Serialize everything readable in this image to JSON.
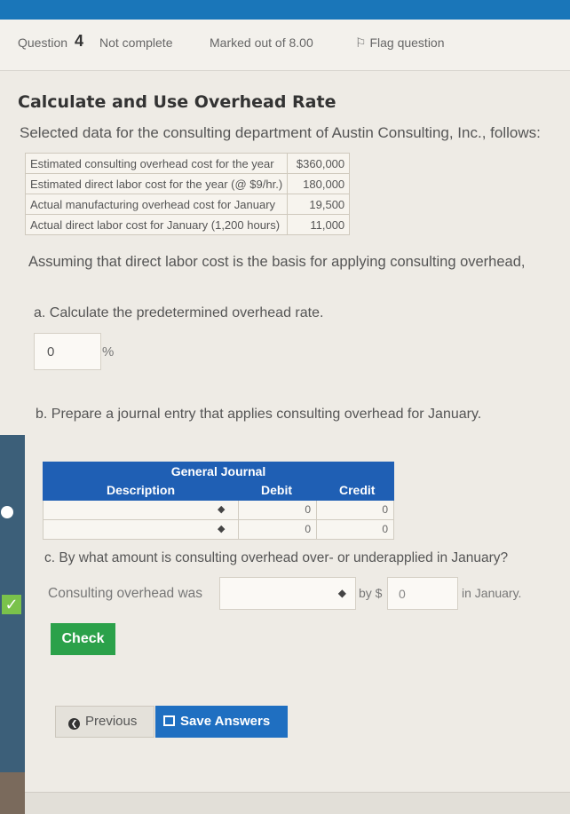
{
  "info": {
    "question_label": "Question",
    "question_number": "4",
    "status": "Not complete",
    "marks": "Marked out of 8.00",
    "flag": "Flag question"
  },
  "title": "Calculate and Use Overhead Rate",
  "intro": "Selected data for the consulting department of Austin Consulting, Inc., follows:",
  "data_rows": [
    {
      "label": "Estimated consulting overhead cost for the year",
      "amount": "$360,000"
    },
    {
      "label": "Estimated direct labor cost for the year (@ $9/hr.)",
      "amount": "180,000"
    },
    {
      "label": "Actual manufacturing overhead cost for January",
      "amount": "19,500"
    },
    {
      "label": "Actual direct labor cost for January (1,200 hours)",
      "amount": "11,000"
    }
  ],
  "assumption": "Assuming that direct labor cost is the basis for applying consulting overhead,",
  "part_a": {
    "question": "a. Calculate the predetermined overhead rate.",
    "value": "0",
    "unit": "%"
  },
  "part_b": {
    "question": "b. Prepare a journal entry that applies consulting overhead for January.",
    "journal": {
      "title": "General Journal",
      "col_description": "Description",
      "col_debit": "Debit",
      "col_credit": "Credit",
      "rows": [
        {
          "debit": "0",
          "credit": "0"
        },
        {
          "debit": "0",
          "credit": "0"
        }
      ]
    }
  },
  "part_c": {
    "question": "c. By what amount is consulting overhead over- or underapplied in January?",
    "prefix": "Consulting overhead was",
    "by_label": "by $",
    "amount": "0",
    "suffix": "in January."
  },
  "buttons": {
    "check": "Check",
    "previous": "Previous",
    "save": "Save Answers"
  },
  "colors": {
    "accent_blue": "#1f5fb4",
    "check_green": "#2ba14a"
  }
}
